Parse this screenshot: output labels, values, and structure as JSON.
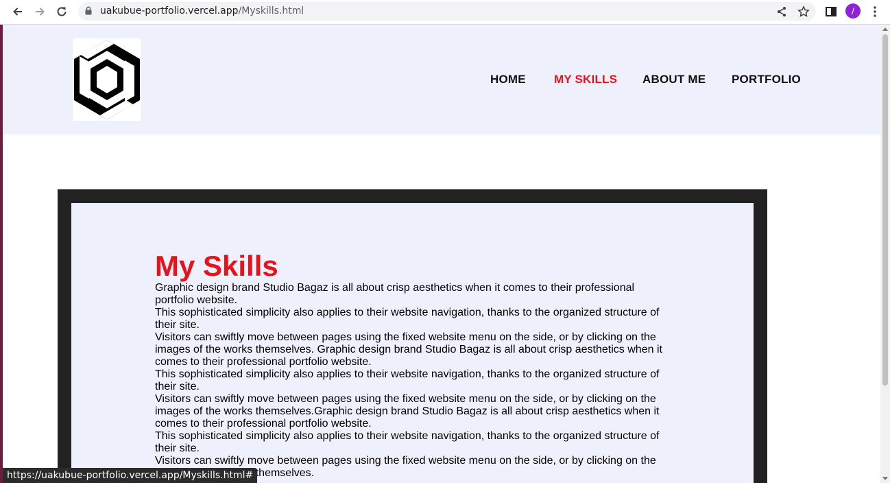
{
  "browser": {
    "url_host": "uakubue-portfolio.vercel.app",
    "url_path": "/Myskills.html",
    "avatar_letter": "/",
    "status_url": "https://uakubue-portfolio.vercel.app/Myskills.html#"
  },
  "site": {
    "nav": [
      {
        "label": "HOME",
        "active": false
      },
      {
        "label": "MY SKILLS",
        "active": true
      },
      {
        "label": "ABOUT ME",
        "active": false
      },
      {
        "label": "PORTFOLIO",
        "active": false
      }
    ],
    "accent_color": "#e8131a",
    "header_bg": "#eef0fc"
  },
  "content": {
    "title": "My Skills",
    "paragraphs": [
      "Graphic design brand Studio Bagaz is all about crisp aesthetics when it comes to their professional portfolio website.",
      "This sophisticated simplicity also applies to their website navigation, thanks to the organized structure of their site.",
      "Visitors can swiftly move between pages using the fixed website menu on the side, or by clicking on the images of the works themselves. Graphic design brand Studio Bagaz is all about crisp aesthetics when it comes to their professional portfolio website.",
      "This sophisticated simplicity also applies to their website navigation, thanks to the organized structure of their site.",
      "Visitors can swiftly move between pages using the fixed website menu on the side, or by clicking on the images of the works themselves.Graphic design brand Studio Bagaz is all about crisp aesthetics when it comes to their professional portfolio website.",
      "This sophisticated simplicity also applies to their website navigation, thanks to the organized structure of their site.",
      "Visitors can swiftly move between pages using the fixed website menu on the side, or by clicking on the images of the works themselves."
    ]
  }
}
